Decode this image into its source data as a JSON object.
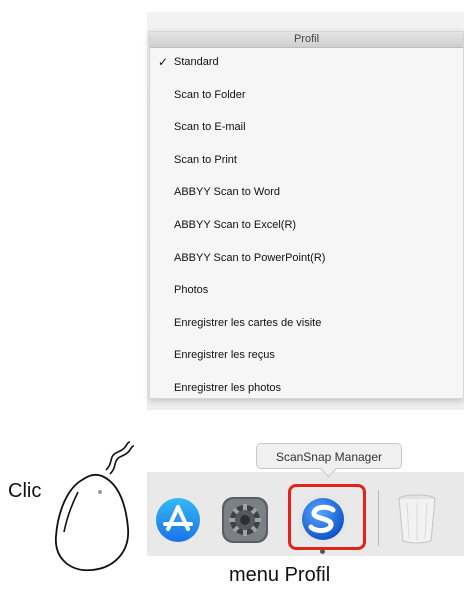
{
  "menu": {
    "title": "Profil",
    "items": [
      {
        "label": "Standard",
        "checked": true
      },
      {
        "label": "Scan to Folder",
        "checked": false
      },
      {
        "label": "Scan to E-mail",
        "checked": false
      },
      {
        "label": "Scan to Print",
        "checked": false
      },
      {
        "label": "ABBYY Scan to Word",
        "checked": false
      },
      {
        "label": "ABBYY Scan to Excel(R)",
        "checked": false
      },
      {
        "label": "ABBYY Scan to PowerPoint(R)",
        "checked": false
      },
      {
        "label": "Photos",
        "checked": false
      },
      {
        "label": "Enregistrer les cartes de visite",
        "checked": false
      },
      {
        "label": "Enregistrer les reçus",
        "checked": false
      },
      {
        "label": "Enregistrer les photos",
        "checked": false
      }
    ],
    "check_mark": "✓"
  },
  "dock": {
    "tooltip": "ScanSnap Manager",
    "apps": [
      {
        "icon": "app-store-icon"
      },
      {
        "icon": "system-preferences-icon"
      },
      {
        "icon": "scansnap-manager-icon"
      },
      {
        "icon": "trash-icon"
      }
    ],
    "highlight_color": "#e2231a"
  },
  "annotations": {
    "clic_label": "Clic",
    "caption": "menu Profil"
  }
}
